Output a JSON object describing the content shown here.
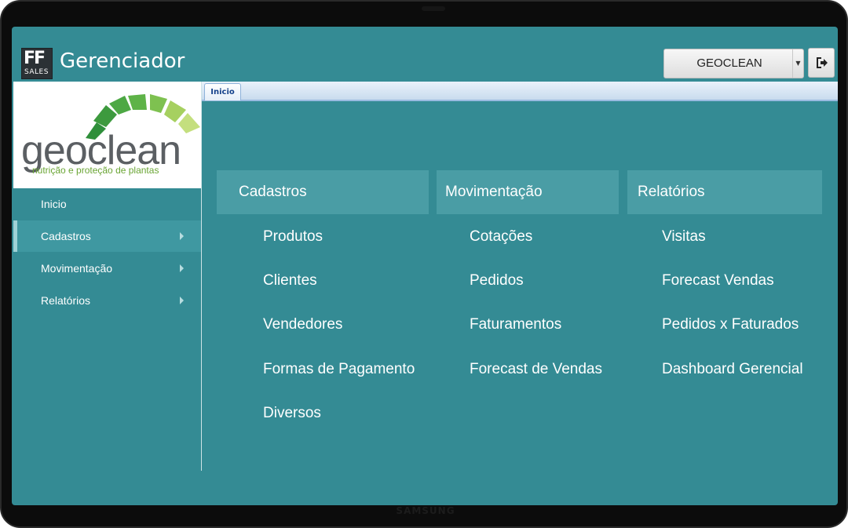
{
  "header": {
    "logo_ff": "FF",
    "logo_sales": "SALES",
    "title": "Gerenciador",
    "company_select": {
      "value": "GEOCLEAN"
    },
    "logout_icon": "sign-out-icon"
  },
  "brand": {
    "word": "geoclean",
    "tagline": "nutrição e proteção de plantas",
    "colors": {
      "leaf_dark": "#2f8f3a",
      "leaf_mid": "#57b047",
      "leaf_light": "#a6d060",
      "text": "#5b5f63",
      "tagline": "#6aa534"
    }
  },
  "sidebar": {
    "items": [
      {
        "label": "Inicio",
        "has_submenu": false,
        "active": false
      },
      {
        "label": "Cadastros",
        "has_submenu": true,
        "active": true
      },
      {
        "label": "Movimentação",
        "has_submenu": true,
        "active": false
      },
      {
        "label": "Relatórios",
        "has_submenu": true,
        "active": false
      }
    ]
  },
  "tabs": [
    {
      "label": "Inicio",
      "active": true
    }
  ],
  "menu": {
    "columns": [
      {
        "title": "Cadastros",
        "links": [
          "Produtos",
          "Clientes",
          "Vendedores",
          "Formas de Pagamento",
          "Diversos"
        ]
      },
      {
        "title": "Movimentação",
        "links": [
          "Cotações",
          "Pedidos",
          "Faturamentos",
          "Forecast de Vendas"
        ]
      },
      {
        "title": "Relatórios",
        "links": [
          "Visitas",
          "Forecast Vendas",
          "Pedidos x Faturados",
          "Dashboard Gerencial"
        ]
      }
    ]
  },
  "device": {
    "brand": "SAMSUNG"
  },
  "colors": {
    "background": "#348b94",
    "panel_header": "#4a9da5",
    "active_item": "#3f98a1",
    "tab_text": "#15428b"
  }
}
